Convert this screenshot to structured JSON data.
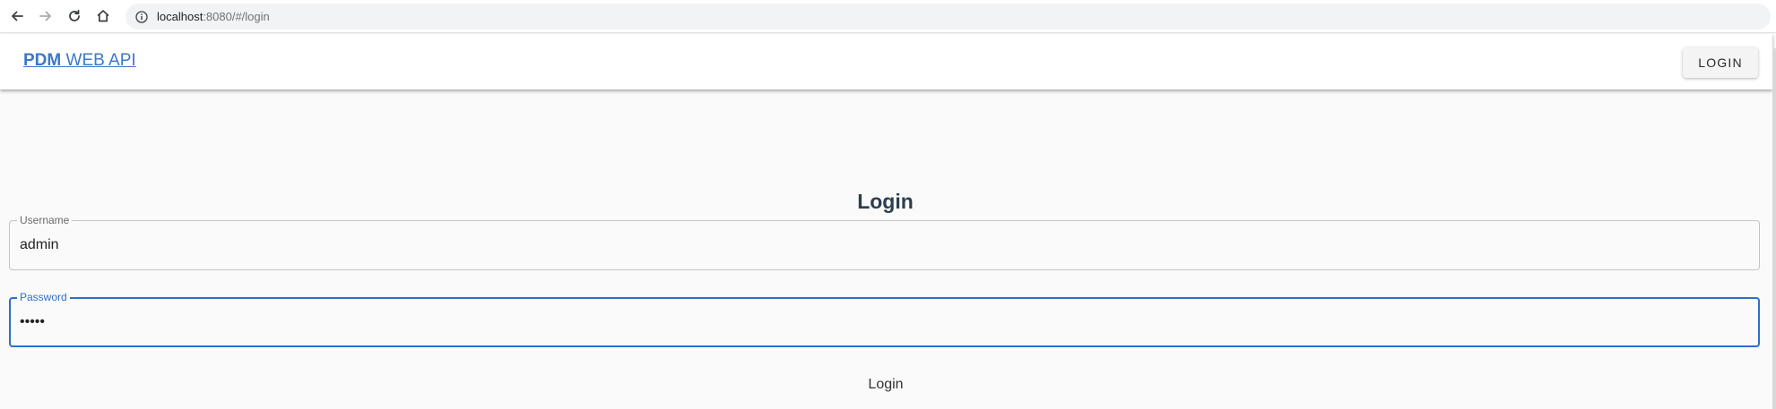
{
  "browser": {
    "url_host": "localhost",
    "url_rest": ":8080/#/login"
  },
  "icons": {
    "back": "arrow-left-icon",
    "forward": "arrow-right-icon",
    "reload": "reload-icon",
    "home": "home-icon",
    "info": "info-icon"
  },
  "header": {
    "brand_bold": "PDM",
    "brand_light": " WEB API",
    "login_button": "LOGIN"
  },
  "form": {
    "title": "Login",
    "username": {
      "label": "Username",
      "value": "admin"
    },
    "password": {
      "label": "Password",
      "value": "admin"
    },
    "submit_label": "Login"
  },
  "colors": {
    "brand": "#3c78c9",
    "focus": "#2f6fc7",
    "title": "#2c3e50",
    "background": "#fafafa"
  }
}
